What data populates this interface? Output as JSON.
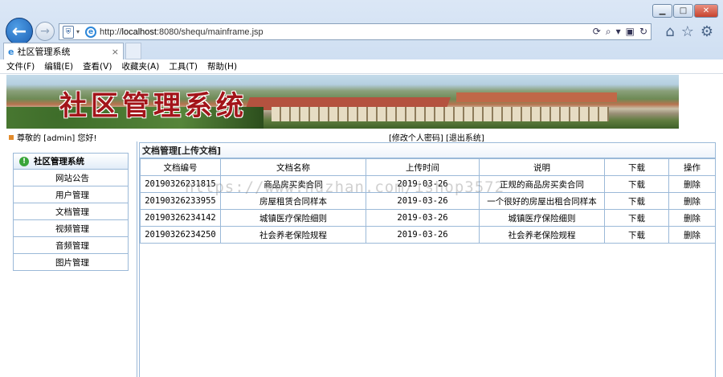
{
  "browser": {
    "url_prefix": "http://",
    "url_host": "localhost",
    "url_rest": ":8080/shequ/mainframe.jsp",
    "tab_title": "社区管理系统",
    "tab_close": "×"
  },
  "menu": [
    "文件(F)",
    "编辑(E)",
    "查看(V)",
    "收藏夹(A)",
    "工具(T)",
    "帮助(H)"
  ],
  "banner": {
    "title": "社区管理系统"
  },
  "infobar": {
    "welcome": "尊敬的 [admin] 您好!",
    "links": "[修改个人密码] [退出系统]"
  },
  "sidebar": {
    "title": "社区管理系统",
    "items": [
      "网站公告",
      "用户管理",
      "文档管理",
      "视频管理",
      "音频管理",
      "图片管理"
    ]
  },
  "main": {
    "caption": "文档管理[上传文档]",
    "columns": [
      "文档编号",
      "文档名称",
      "上传时间",
      "说明",
      "下载",
      "操作"
    ],
    "rows": [
      [
        "20190326231815",
        "商品房买卖合同",
        "2019-03-26",
        "正规的商品房买卖合同",
        "下载",
        "删除"
      ],
      [
        "20190326233955",
        "房屋租赁合同样本",
        "2019-03-26",
        "一个很好的房屋出租合同样本",
        "下载",
        "删除"
      ],
      [
        "20190326234142",
        "城镇医疗保险细则",
        "2019-03-26",
        "城镇医疗保险细则",
        "下载",
        "删除"
      ],
      [
        "20190326234250",
        "社会养老保险规程",
        "2019-03-26",
        "社会养老保险规程",
        "下载",
        "删除"
      ]
    ]
  },
  "watermark": "https://www.huzhan.com/ishop3572"
}
